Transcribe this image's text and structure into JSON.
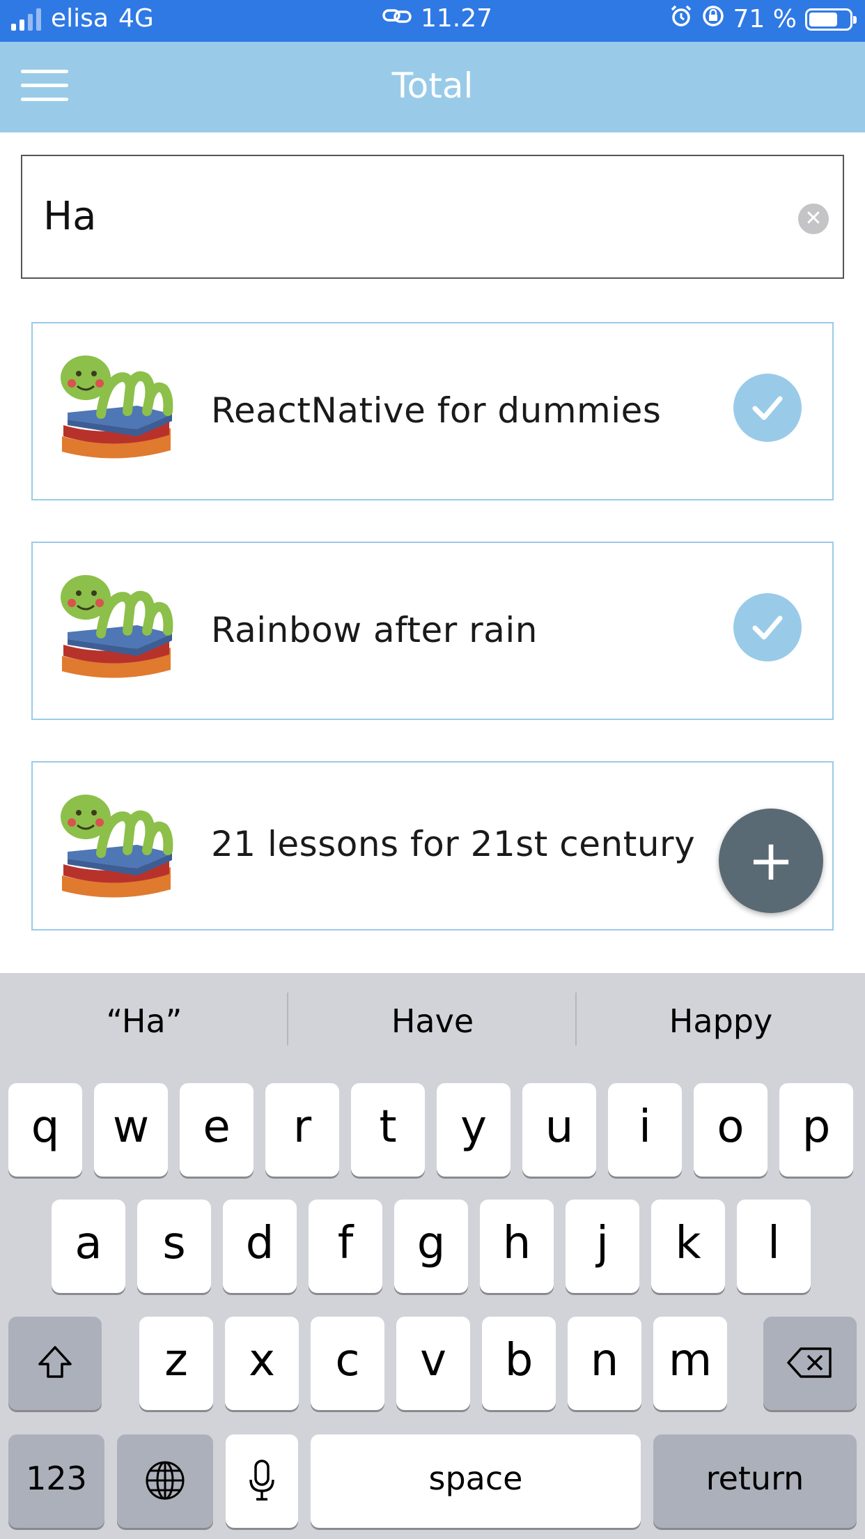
{
  "status_bar": {
    "carrier": "elisa",
    "network": "4G",
    "time": "11.27",
    "battery_percent": "71 %",
    "battery_level": 0.71
  },
  "nav": {
    "title": "Total",
    "menu_icon": "hamburger-menu-icon"
  },
  "search": {
    "value": "Ha",
    "clear_icon": "clear-circle-icon"
  },
  "books": [
    {
      "title": "ReactNative for dummies",
      "status_icon": "checkmark-icon"
    },
    {
      "title": "Rainbow after rain",
      "status_icon": "checkmark-icon"
    },
    {
      "title": "21 lessons for 21st century",
      "status_icon": ""
    }
  ],
  "fab": {
    "label": "+",
    "icon": "plus-icon"
  },
  "keyboard": {
    "suggestions": [
      "“Ha”",
      "Have",
      "Happy"
    ],
    "row1": [
      "q",
      "w",
      "e",
      "r",
      "t",
      "y",
      "u",
      "i",
      "o",
      "p"
    ],
    "row2": [
      "a",
      "s",
      "d",
      "f",
      "g",
      "h",
      "j",
      "k",
      "l"
    ],
    "row3": [
      "z",
      "x",
      "c",
      "v",
      "b",
      "n",
      "m"
    ],
    "numbers_key": "123",
    "space_key": "space",
    "return_key": "return"
  },
  "colors": {
    "status_bar": "#2f79e4",
    "nav_bar": "#99cbe9",
    "card_border": "#99cbe9",
    "fab": "#596a74",
    "keyboard": "#d1d3d9"
  }
}
